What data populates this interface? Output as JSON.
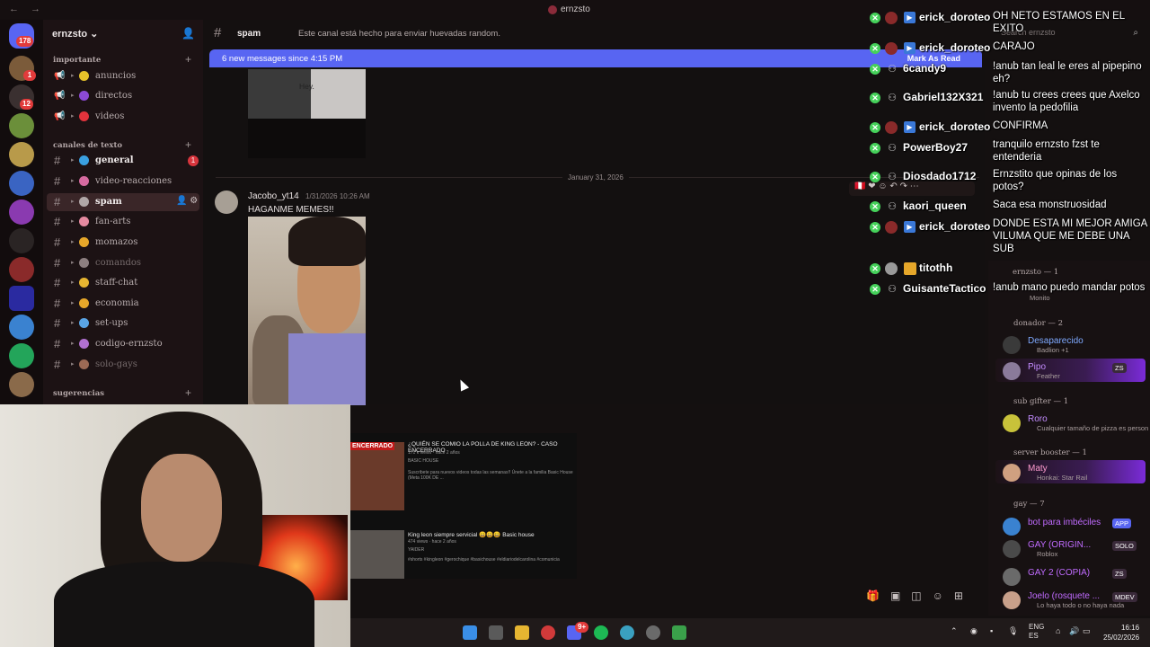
{
  "window": {
    "title": "ernzsto",
    "nav_back": "←",
    "nav_fwd": "→",
    "search_placeholder": "Search ernzsto"
  },
  "server": {
    "name": "ernzsto",
    "rail_badges": [
      "178",
      "1",
      "12"
    ]
  },
  "categories": {
    "importante": "importante",
    "canales": "canales de texto",
    "sugerencias": "sugerencias"
  },
  "channels": [
    {
      "name": "anuncios",
      "type": "announce",
      "color": "#e6c22a",
      "unread": ""
    },
    {
      "name": "directos",
      "type": "announce",
      "color": "#8c4ad6",
      "unread": ""
    },
    {
      "name": "videos",
      "type": "announce",
      "color": "#e1333c",
      "unread": ""
    },
    {
      "name": "general",
      "type": "text",
      "color": "#3aa0e0",
      "unread": "1"
    },
    {
      "name": "video-reacciones",
      "type": "text",
      "color": "#d66aa0",
      "unread": ""
    },
    {
      "name": "spam",
      "type": "text",
      "color": "#b0a7a7",
      "unread": ""
    },
    {
      "name": "fan-arts",
      "type": "text",
      "color": "#e58aa0",
      "unread": ""
    },
    {
      "name": "momazos",
      "type": "text",
      "color": "#e6a72a",
      "unread": ""
    },
    {
      "name": "comandos",
      "type": "text",
      "color": "#8d7f80",
      "unread": ""
    },
    {
      "name": "staff-chat",
      "type": "text",
      "color": "#e6b531",
      "unread": ""
    },
    {
      "name": "economia",
      "type": "text",
      "color": "#e6a72a",
      "unread": ""
    },
    {
      "name": "set-ups",
      "type": "text",
      "color": "#5aa5e6",
      "unread": ""
    },
    {
      "name": "codigo-ernzsto",
      "type": "text",
      "color": "#b070d0",
      "unread": ""
    },
    {
      "name": "solo-gays",
      "type": "text",
      "color": "#9c6a55",
      "unread": ""
    }
  ],
  "chat": {
    "channel_name": "spam",
    "topic": "Este canal está hecho para enviar huevadas random.",
    "new_messages": "6 new messages since 4:15 PM",
    "mark_as_read": "Mark As Read",
    "image_caption": "Hey.",
    "date_divider": "January 31, 2026",
    "message": {
      "author": "Jacobo_yt14",
      "time": "1/31/2026 10:26 AM",
      "text": "HAGANME MEMES!!"
    }
  },
  "youtube": {
    "thumb_label": "ENCERRADO",
    "video1_title": "¿QUIÉN SE COMIO LA POLLA DE KING LEON? - CASO ENCERRADO",
    "video1_meta": "171 k views · hace 2 años",
    "video1_channel": "BASIC HOUSE",
    "video1_desc": "Suscribete para nuevos videos todas las semanas!! Únete a la familia Basic House (Meta 100K DE ...",
    "video2_title": "King leon siempre servicial 😀😀😀 Basic house",
    "video2_meta": "474 views · hace 2 años",
    "video2_channel": "YAIDER",
    "video2_desc": "#shorts #kingleon #gerochique #basichouse #eldiariodelcarolina #comunicia"
  },
  "twitch_chat": [
    {
      "user": "erick_doroteo",
      "message": "OH NETO ESTAMOS EN EL EXITO",
      "badge": "sub"
    },
    {
      "user": "erick_doroteo",
      "message": "CARAJO",
      "badge": "sub"
    },
    {
      "user": "6candy9",
      "message": "!anub tan leal le eres al pipepino eh?",
      "badge": "person"
    },
    {
      "user": "Gabriel132X321",
      "message": "!anub tu crees crees que Axelco invento la pedofilia",
      "badge": "person"
    },
    {
      "user": "erick_doroteo",
      "message": "CONFIRMA",
      "badge": "sub"
    },
    {
      "user": "PowerBoy27",
      "message": "tranquilo ernzsto fzst te entenderia",
      "badge": "person"
    },
    {
      "user": "Diosdado1712",
      "message": "Ernzstito que opinas de los potos?",
      "badge": "person"
    },
    {
      "user": "kaori_queen",
      "message": "Saca esa monstruosidad",
      "badge": "person"
    },
    {
      "user": "erick_doroteo",
      "message": "DONDE ESTA MI MEJOR AMIGA VILUMA QUE ME DEBE UNA SUB",
      "badge": "sub"
    },
    {
      "user": "titothh",
      "message": "",
      "badge": "crown"
    },
    {
      "user": "GuisanteTactico",
      "message": "!anub mano puedo mandar potos",
      "badge": "person"
    }
  ],
  "members": {
    "ernzsto_group": "ernzsto — 1",
    "ernzsto_sub": "Monito",
    "donador_group": "donador — 2",
    "donador": [
      {
        "name": "Desaparecido",
        "sub": "Badlion +1",
        "color": "#7ea9ff"
      },
      {
        "name": "Pipo",
        "sub": "Feather",
        "color": "#c38cff",
        "tag": "ZS"
      }
    ],
    "subgifter_group": "sub gifter — 1",
    "subgifter": [
      {
        "name": "Roro",
        "sub": "Cualquier tamaño de pizza es person",
        "color": "#c38cff"
      }
    ],
    "booster_group": "server booster — 1",
    "booster": [
      {
        "name": "Maty",
        "sub": "Honkai: Star Rail",
        "color": "#ff9ccf"
      }
    ],
    "gay_group": "gay — 7",
    "gay": [
      {
        "name": "bot para imbéciles",
        "sub": "",
        "color": "#c06bff",
        "tag": "APP"
      },
      {
        "name": "GAY (ORIGIN...",
        "sub": "Roblox",
        "color": "#c06bff",
        "tag": "SOLO"
      },
      {
        "name": "GAY 2 (COPIA)",
        "sub": "",
        "color": "#c06bff",
        "tag": "ZS"
      },
      {
        "name": "Joelo (rosquete ...",
        "sub": "Lo haya todo o no haya nada",
        "color": "#c06bff",
        "tag": "MDEV"
      }
    ]
  },
  "taskbar": {
    "lang": "ENG",
    "lang2": "ES",
    "time": "16:16",
    "date": "25/02/2026",
    "discord_badge": "9+"
  },
  "colors": {
    "accent": "#5865f2",
    "badge": "#e23b3b",
    "twitch_green": "#45d15a"
  }
}
